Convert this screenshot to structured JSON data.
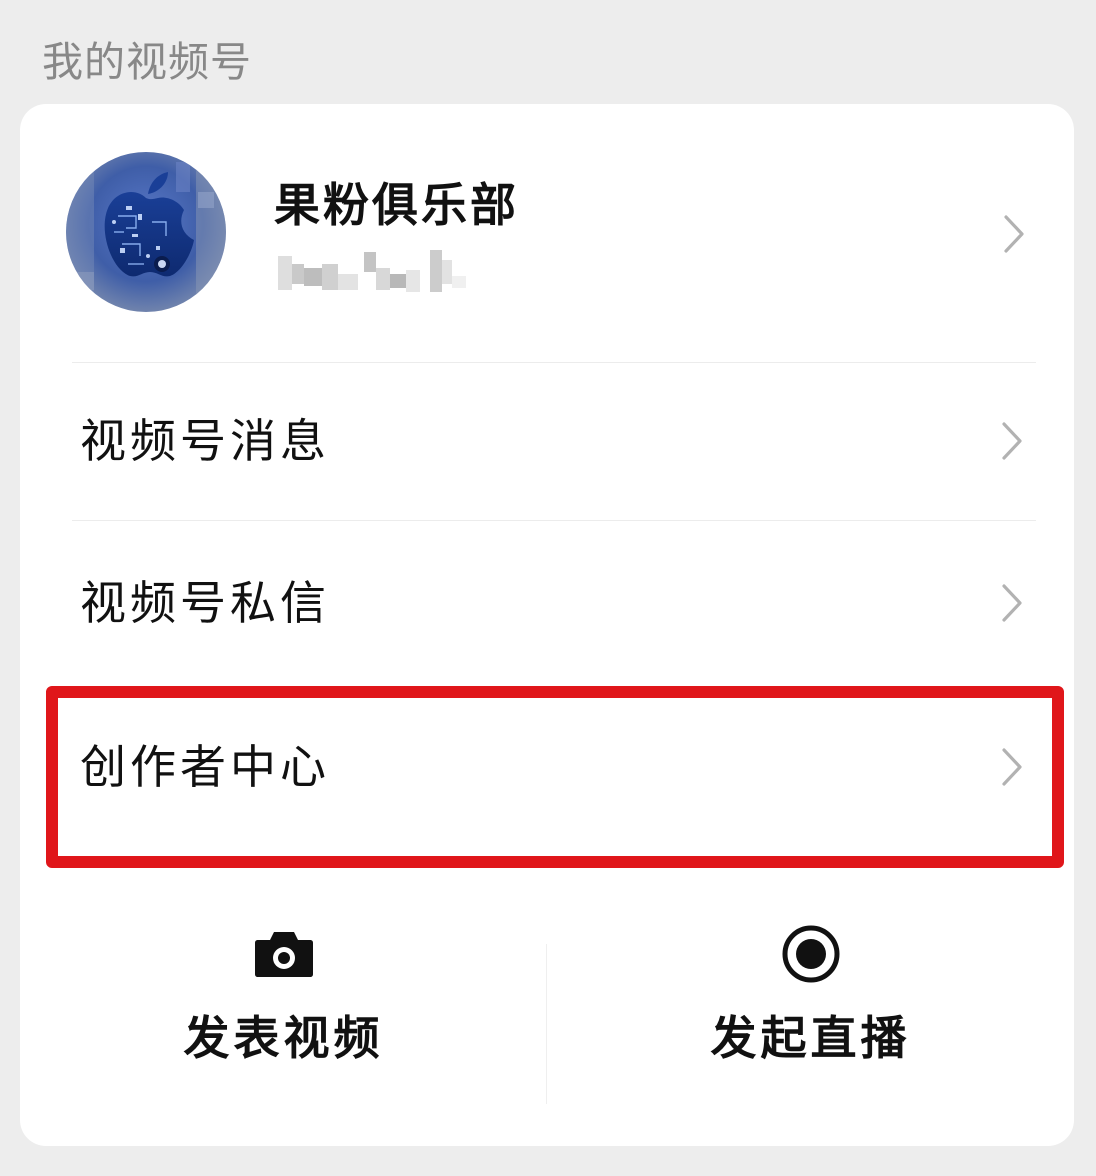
{
  "section": {
    "title": "我的视频号"
  },
  "profile": {
    "name": "果粉俱乐部",
    "avatar_icon": "apple-circuit-avatar",
    "id_obscured": true
  },
  "menu": [
    {
      "label": "视频号消息",
      "icon": "chevron-right-icon"
    },
    {
      "label": "视频号私信",
      "icon": "chevron-right-icon"
    },
    {
      "label": "创作者中心",
      "icon": "chevron-right-icon",
      "highlighted": true
    }
  ],
  "actions": [
    {
      "label": "发表视频",
      "icon": "camera-icon"
    },
    {
      "label": "发起直播",
      "icon": "record-icon"
    }
  ],
  "colors": {
    "background": "#ededed",
    "card": "#ffffff",
    "highlight": "#e0161a",
    "chevron": "#b2b2b2",
    "section_title": "#888888"
  }
}
